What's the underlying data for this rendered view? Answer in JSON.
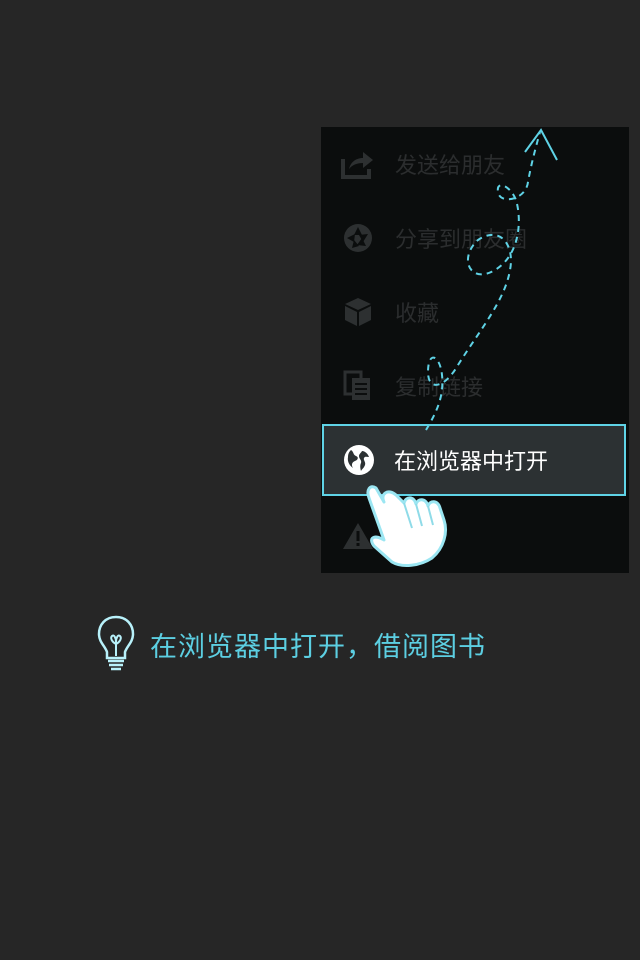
{
  "menu": {
    "items": [
      {
        "label": "发送给朋友",
        "icon": "share-icon"
      },
      {
        "label": "分享到朋友圈",
        "icon": "camera-aperture-icon"
      },
      {
        "label": "收藏",
        "icon": "box-icon"
      },
      {
        "label": "复制链接",
        "icon": "copy-icon"
      },
      {
        "label": "在浏览器中打开",
        "icon": "globe-icon"
      },
      {
        "label": "",
        "icon": "warning-icon"
      }
    ],
    "highlighted_index": 4
  },
  "hint": {
    "text": "在浏览器中打开，借阅图书",
    "icon": "lightbulb-icon"
  },
  "colors": {
    "background": "#262626",
    "menu_background": "#0b0d0d",
    "highlight_background": "#2c3133",
    "accent": "#5fd3e6",
    "hint_text": "#5ccfe2",
    "dim_text": "#2b2d2e"
  }
}
